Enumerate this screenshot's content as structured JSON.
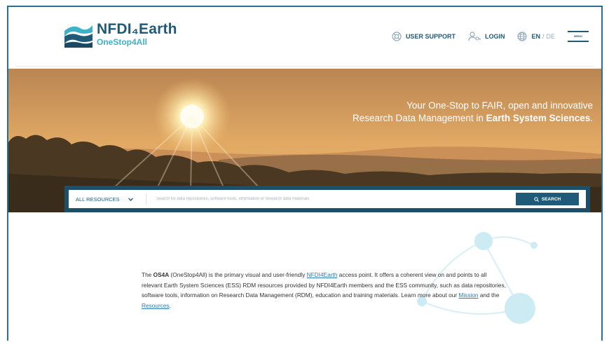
{
  "header": {
    "logo_title": "NFDI₄Earth",
    "logo_subtitle": "OneStop4All",
    "nav": {
      "user_support": "USER SUPPORT",
      "login": "LOGIN",
      "lang_en": "EN",
      "lang_sep": "/",
      "lang_de": "DE",
      "menu_label": "MENU"
    }
  },
  "hero": {
    "tagline_line1": "Your One-Stop to FAIR, open and innovative",
    "tagline_line2_prefix": "Research Data Management in ",
    "tagline_line2_bold": "Earth System Sciences",
    "tagline_line2_suffix": "."
  },
  "search": {
    "category": "ALL RESOURCES",
    "placeholder": "Search for data repositories, software tools, information or research data materials",
    "button": "SEARCH"
  },
  "intro": {
    "t1": "The ",
    "b1": "OS4A",
    "t2": " (OneStop4All) is the primary visual and user-friendly ",
    "link1": "NFDI4Earth",
    "t3": " access point. It offers a coherent view on and points to all relevant Earth System Sciences (ESS) RDM resources provided by NFDI4Earth members and the ESS community, such as data repositories, software tools, information on Research Data Management (RDM), education and training materials. Learn more about our ",
    "link2": "Mission",
    "t4": " and the ",
    "link3": "Resources",
    "t5": "."
  },
  "colors": {
    "brand_dark": "#1f5a78",
    "brand_light": "#3fb0c9",
    "link": "#2a7ab0"
  }
}
